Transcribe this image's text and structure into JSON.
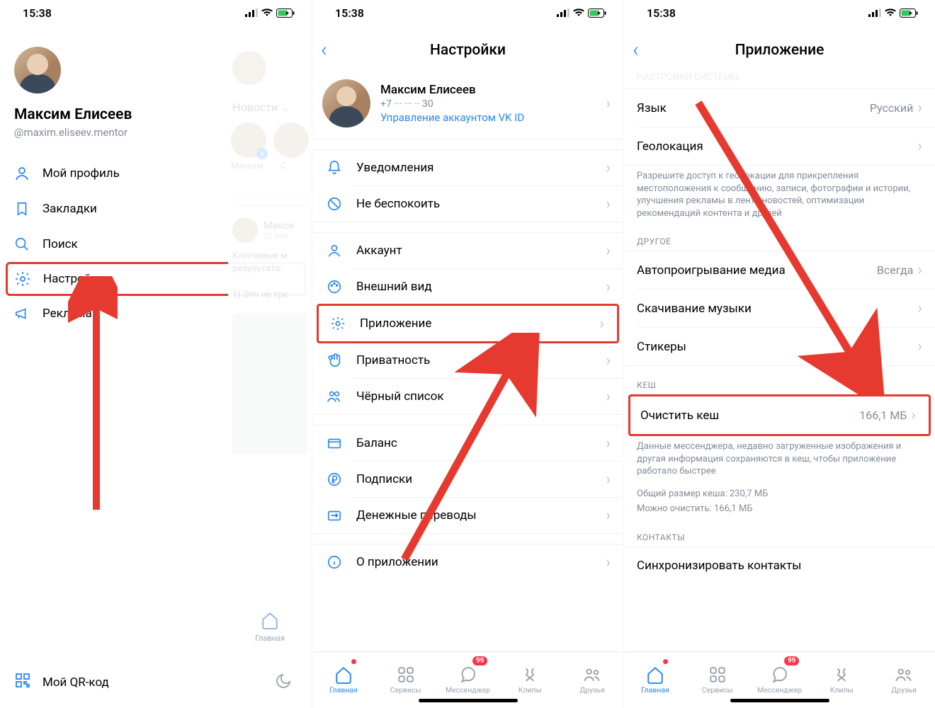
{
  "status": {
    "time": "15:38"
  },
  "screen1": {
    "name": "Максим Елисеев",
    "handle": "@maxim.eliseev.mentor",
    "menu": {
      "profile": "Мой профиль",
      "bookmarks": "Закладки",
      "search": "Поиск",
      "settings": "Настройки",
      "ads": "Реклама"
    },
    "qr": "Мой QR-код",
    "ghost": {
      "news": "Новости",
      "storyMe": "Максим",
      "storyOther": "С",
      "postName": "Макси",
      "postDate": "22 ноя",
      "postLine1": "Ключевые м",
      "postLine2": "результата:",
      "postLine3": "1) Это не тре",
      "tab": "Главная"
    }
  },
  "screen2": {
    "title": "Настройки",
    "profile": {
      "name": "Максим Елисеев",
      "phone": "+7 ··· ··· ·· 30",
      "link": "Управление аккаунтом VK ID"
    },
    "items": {
      "notifications": "Уведомления",
      "dnd": "Не беспокоить",
      "account": "Аккаунт",
      "appearance": "Внешний вид",
      "app": "Приложение",
      "privacy": "Приватность",
      "blacklist": "Чёрный список",
      "balance": "Баланс",
      "subscriptions": "Подписки",
      "transfers": "Денежные переводы",
      "about": "О приложении"
    }
  },
  "screen3": {
    "title": "Приложение",
    "topGhost": "НАСТРОЙКИ СИСТЕМЫ",
    "lang": {
      "label": "Язык",
      "value": "Русский"
    },
    "geo": {
      "label": "Геолокация",
      "desc": "Разрешите доступ к геолокации для прикрепления местоположения к сообщению, записи, фотографии и истории, улучшения рекламы в ленте новостей, оптимизации рекомендаций контента и друзей"
    },
    "group_other": "ДРУГОЕ",
    "autoplay": {
      "label": "Автопроигрывание медиа",
      "value": "Всегда"
    },
    "music": "Скачивание музыки",
    "stickers": "Стикеры",
    "group_cache": "КЕШ",
    "clear": {
      "label": "Очистить кеш",
      "value": "166,1 МБ"
    },
    "cache_desc": "Данные мессенджера, недавно загруженные изображения и другая информация сохраняются в кеш, чтобы приложение работало быстрее",
    "cache_total": "Общий размер кеша: 230,7 МБ",
    "cache_can": "Можно очистить: 166,1 МБ",
    "group_contacts": "КОНТАКТЫ",
    "contacts": "Синхронизировать контакты"
  },
  "tabs": {
    "home": "Главная",
    "services": "Сервисы",
    "messenger": "Мессенджер",
    "clips": "Клипы",
    "friends": "Друзья",
    "badge": "99"
  }
}
